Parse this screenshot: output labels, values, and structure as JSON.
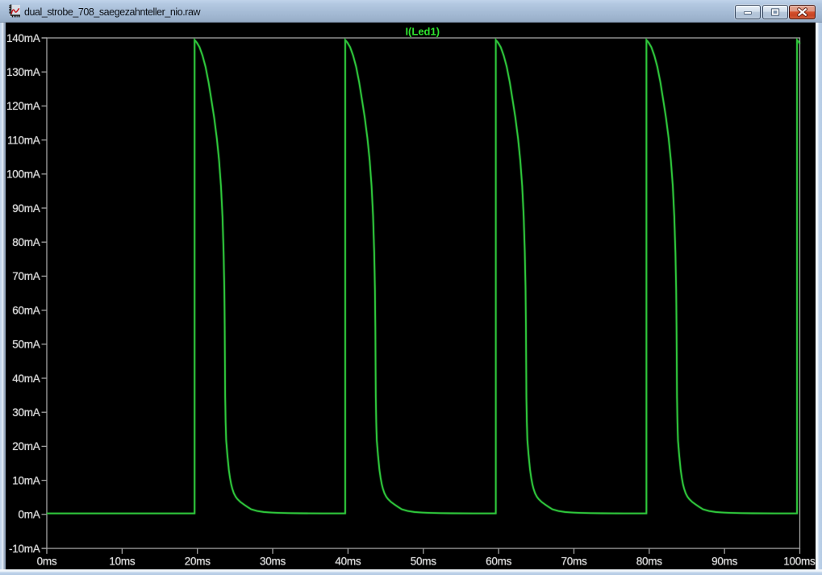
{
  "window": {
    "title": "dual_strobe_708_saegezahnteller_nio.raw",
    "icon": "waveform-file-icon",
    "controls": {
      "minimize_label": "Minimize",
      "maximize_label": "Maximize",
      "close_label": "Close"
    }
  },
  "chart_data": {
    "type": "line",
    "title": "I(Led1)",
    "xlabel": "",
    "ylabel": "",
    "x_unit": "ms",
    "y_unit": "mA",
    "xlim": [
      0,
      100
    ],
    "ylim": [
      -10,
      140
    ],
    "grid": false,
    "legend_position": "top-center",
    "x_ticks": [
      {
        "value": 0,
        "label": "0ms"
      },
      {
        "value": 10,
        "label": "10ms"
      },
      {
        "value": 20,
        "label": "20ms"
      },
      {
        "value": 30,
        "label": "30ms"
      },
      {
        "value": 40,
        "label": "40ms"
      },
      {
        "value": 50,
        "label": "50ms"
      },
      {
        "value": 60,
        "label": "60ms"
      },
      {
        "value": 70,
        "label": "70ms"
      },
      {
        "value": 80,
        "label": "80ms"
      },
      {
        "value": 90,
        "label": "90ms"
      },
      {
        "value": 100,
        "label": "100ms"
      }
    ],
    "y_ticks": [
      {
        "value": 140,
        "label": "140mA"
      },
      {
        "value": 130,
        "label": "130mA"
      },
      {
        "value": 120,
        "label": "120mA"
      },
      {
        "value": 110,
        "label": "110mA"
      },
      {
        "value": 100,
        "label": "100mA"
      },
      {
        "value": 90,
        "label": "90mA"
      },
      {
        "value": 80,
        "label": "80mA"
      },
      {
        "value": 70,
        "label": "70mA"
      },
      {
        "value": 60,
        "label": "60mA"
      },
      {
        "value": 50,
        "label": "50mA"
      },
      {
        "value": 40,
        "label": "40mA"
      },
      {
        "value": 30,
        "label": "30mA"
      },
      {
        "value": 20,
        "label": "20mA"
      },
      {
        "value": 10,
        "label": "10mA"
      },
      {
        "value": 0,
        "label": "0mA"
      },
      {
        "value": -10,
        "label": "-10mA"
      }
    ],
    "series": [
      {
        "name": "I(Led1)",
        "color": "#2fc83c",
        "points": [
          [
            0,
            0.27
          ],
          [
            19.63,
            0.27
          ],
          [
            19.63,
            139.4
          ],
          [
            19.93,
            138.6
          ],
          [
            20.28,
            137.3
          ],
          [
            20.68,
            134.8
          ],
          [
            21.08,
            131.5
          ],
          [
            21.48,
            127.0
          ],
          [
            21.88,
            121.5
          ],
          [
            22.23,
            116.5
          ],
          [
            22.58,
            110.5
          ],
          [
            22.88,
            104.0
          ],
          [
            23.13,
            96.5
          ],
          [
            23.33,
            87.5
          ],
          [
            23.48,
            77.0
          ],
          [
            23.58,
            66.0
          ],
          [
            23.63,
            55.0
          ],
          [
            23.66,
            44.5
          ],
          [
            23.69,
            34.5
          ],
          [
            23.75,
            27.0
          ],
          [
            23.82,
            21.8
          ],
          [
            23.98,
            17.5
          ],
          [
            24.18,
            13.0
          ],
          [
            24.33,
            10.7
          ],
          [
            24.49,
            8.8
          ],
          [
            24.63,
            7.6
          ],
          [
            24.84,
            6.2
          ],
          [
            25.08,
            5.2
          ],
          [
            25.31,
            4.5
          ],
          [
            25.73,
            3.6
          ],
          [
            26.17,
            2.9
          ],
          [
            26.63,
            2.2
          ],
          [
            27.13,
            1.5
          ],
          [
            27.93,
            1.0
          ],
          [
            28.83,
            0.68
          ],
          [
            29.93,
            0.52
          ],
          [
            30.63,
            0.45
          ],
          [
            32.13,
            0.36
          ],
          [
            33.63,
            0.32
          ],
          [
            36.63,
            0.27
          ],
          [
            39.63,
            0.27
          ],
          [
            39.63,
            139.4
          ],
          [
            39.93,
            138.6
          ],
          [
            40.28,
            137.3
          ],
          [
            40.68,
            134.8
          ],
          [
            41.08,
            131.5
          ],
          [
            41.48,
            127.0
          ],
          [
            41.88,
            121.5
          ],
          [
            42.23,
            116.5
          ],
          [
            42.58,
            110.5
          ],
          [
            42.88,
            104.0
          ],
          [
            43.13,
            96.5
          ],
          [
            43.33,
            87.5
          ],
          [
            43.48,
            77.0
          ],
          [
            43.58,
            66.0
          ],
          [
            43.63,
            55.0
          ],
          [
            43.66,
            44.5
          ],
          [
            43.69,
            34.5
          ],
          [
            43.75,
            27.0
          ],
          [
            43.82,
            21.8
          ],
          [
            43.98,
            17.5
          ],
          [
            44.18,
            13.0
          ],
          [
            44.33,
            10.7
          ],
          [
            44.49,
            8.8
          ],
          [
            44.63,
            7.6
          ],
          [
            44.84,
            6.2
          ],
          [
            45.08,
            5.2
          ],
          [
            45.31,
            4.5
          ],
          [
            45.73,
            3.6
          ],
          [
            46.17,
            2.9
          ],
          [
            46.63,
            2.2
          ],
          [
            47.13,
            1.5
          ],
          [
            47.93,
            1.0
          ],
          [
            48.83,
            0.68
          ],
          [
            49.93,
            0.52
          ],
          [
            50.63,
            0.45
          ],
          [
            52.13,
            0.36
          ],
          [
            53.63,
            0.32
          ],
          [
            56.63,
            0.27
          ],
          [
            59.63,
            0.27
          ],
          [
            59.63,
            139.4
          ],
          [
            59.93,
            138.6
          ],
          [
            60.28,
            137.3
          ],
          [
            60.68,
            134.8
          ],
          [
            61.08,
            131.5
          ],
          [
            61.48,
            127.0
          ],
          [
            61.88,
            121.5
          ],
          [
            62.23,
            116.5
          ],
          [
            62.58,
            110.5
          ],
          [
            62.88,
            104.0
          ],
          [
            63.13,
            96.5
          ],
          [
            63.33,
            87.5
          ],
          [
            63.48,
            77.0
          ],
          [
            63.58,
            66.0
          ],
          [
            63.63,
            55.0
          ],
          [
            63.66,
            44.5
          ],
          [
            63.69,
            34.5
          ],
          [
            63.75,
            27.0
          ],
          [
            63.82,
            21.8
          ],
          [
            63.98,
            17.5
          ],
          [
            64.18,
            13.0
          ],
          [
            64.33,
            10.7
          ],
          [
            64.49,
            8.8
          ],
          [
            64.63,
            7.6
          ],
          [
            64.84,
            6.2
          ],
          [
            65.08,
            5.2
          ],
          [
            65.31,
            4.5
          ],
          [
            65.73,
            3.6
          ],
          [
            66.17,
            2.9
          ],
          [
            66.63,
            2.2
          ],
          [
            67.13,
            1.5
          ],
          [
            67.93,
            1.0
          ],
          [
            68.83,
            0.68
          ],
          [
            69.93,
            0.52
          ],
          [
            70.63,
            0.45
          ],
          [
            72.13,
            0.36
          ],
          [
            73.63,
            0.32
          ],
          [
            76.63,
            0.27
          ],
          [
            79.63,
            0.27
          ],
          [
            79.63,
            139.4
          ],
          [
            79.93,
            138.6
          ],
          [
            80.28,
            137.3
          ],
          [
            80.68,
            134.8
          ],
          [
            81.08,
            131.5
          ],
          [
            81.48,
            127.0
          ],
          [
            81.88,
            121.5
          ],
          [
            82.23,
            116.5
          ],
          [
            82.58,
            110.5
          ],
          [
            82.88,
            104.0
          ],
          [
            83.13,
            96.5
          ],
          [
            83.33,
            87.5
          ],
          [
            83.48,
            77.0
          ],
          [
            83.58,
            66.0
          ],
          [
            83.63,
            55.0
          ],
          [
            83.66,
            44.5
          ],
          [
            83.69,
            34.5
          ],
          [
            83.75,
            27.0
          ],
          [
            83.82,
            21.8
          ],
          [
            83.98,
            17.5
          ],
          [
            84.18,
            13.0
          ],
          [
            84.33,
            10.7
          ],
          [
            84.49,
            8.8
          ],
          [
            84.63,
            7.6
          ],
          [
            84.84,
            6.2
          ],
          [
            85.08,
            5.2
          ],
          [
            85.31,
            4.5
          ],
          [
            85.73,
            3.6
          ],
          [
            86.17,
            2.9
          ],
          [
            86.63,
            2.2
          ],
          [
            87.13,
            1.5
          ],
          [
            87.93,
            1.0
          ],
          [
            88.83,
            0.68
          ],
          [
            89.93,
            0.52
          ],
          [
            90.63,
            0.45
          ],
          [
            92.13,
            0.36
          ],
          [
            93.63,
            0.32
          ],
          [
            96.63,
            0.27
          ],
          [
            99.63,
            0.27
          ],
          [
            99.63,
            139.4
          ],
          [
            99.93,
            138.6
          ],
          [
            100.0,
            138.3
          ]
        ]
      }
    ],
    "colors": {
      "plot_background": "#000000",
      "axis": "#a3a3a3",
      "tick_text": "#d9d9d9",
      "trace_green": "#2fc83c",
      "title_green": "#2ee22e"
    }
  }
}
